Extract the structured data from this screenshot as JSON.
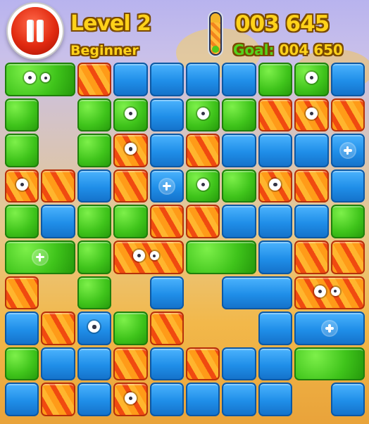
{
  "hud": {
    "level_label": "Level 2",
    "difficulty": "Beginner",
    "score": "003 645",
    "goal_label": "Goal:",
    "goal_value": "004 650",
    "progress": 0.78
  },
  "board": {
    "columns": 10,
    "rows": 10,
    "colors": {
      "green": "#3fc41b",
      "blue": "#1f8ee8",
      "orange": "#f26a12"
    },
    "blocks": [
      {
        "c": 0,
        "r": 0,
        "w": 2,
        "h": 1,
        "t": "g",
        "mark": "eyes"
      },
      {
        "c": 2,
        "r": 0,
        "w": 1,
        "h": 1,
        "t": "o"
      },
      {
        "c": 3,
        "r": 0,
        "w": 1,
        "h": 1,
        "t": "b"
      },
      {
        "c": 4,
        "r": 0,
        "w": 1,
        "h": 1,
        "t": "b"
      },
      {
        "c": 5,
        "r": 0,
        "w": 1,
        "h": 1,
        "t": "b"
      },
      {
        "c": 6,
        "r": 0,
        "w": 1,
        "h": 1,
        "t": "b"
      },
      {
        "c": 7,
        "r": 0,
        "w": 1,
        "h": 1,
        "t": "g"
      },
      {
        "c": 8,
        "r": 0,
        "w": 1,
        "h": 1,
        "t": "g",
        "mark": "eye"
      },
      {
        "c": 9,
        "r": 0,
        "w": 1,
        "h": 1,
        "t": "b"
      },
      {
        "c": 0,
        "r": 1,
        "w": 1,
        "h": 1,
        "t": "g"
      },
      {
        "c": 2,
        "r": 1,
        "w": 1,
        "h": 1,
        "t": "g"
      },
      {
        "c": 3,
        "r": 1,
        "w": 1,
        "h": 1,
        "t": "g",
        "mark": "eye"
      },
      {
        "c": 4,
        "r": 1,
        "w": 1,
        "h": 1,
        "t": "b"
      },
      {
        "c": 5,
        "r": 1,
        "w": 1,
        "h": 1,
        "t": "g",
        "mark": "eye"
      },
      {
        "c": 6,
        "r": 1,
        "w": 1,
        "h": 1,
        "t": "g"
      },
      {
        "c": 7,
        "r": 1,
        "w": 1,
        "h": 1,
        "t": "o"
      },
      {
        "c": 8,
        "r": 1,
        "w": 1,
        "h": 1,
        "t": "o",
        "mark": "eye"
      },
      {
        "c": 9,
        "r": 1,
        "w": 1,
        "h": 1,
        "t": "o"
      },
      {
        "c": 0,
        "r": 2,
        "w": 1,
        "h": 1,
        "t": "g"
      },
      {
        "c": 2,
        "r": 2,
        "w": 1,
        "h": 1,
        "t": "g"
      },
      {
        "c": 3,
        "r": 2,
        "w": 1,
        "h": 1,
        "t": "o",
        "mark": "eye"
      },
      {
        "c": 4,
        "r": 2,
        "w": 1,
        "h": 1,
        "t": "b"
      },
      {
        "c": 5,
        "r": 2,
        "w": 1,
        "h": 1,
        "t": "o"
      },
      {
        "c": 6,
        "r": 2,
        "w": 1,
        "h": 1,
        "t": "b"
      },
      {
        "c": 7,
        "r": 2,
        "w": 1,
        "h": 1,
        "t": "b"
      },
      {
        "c": 8,
        "r": 2,
        "w": 1,
        "h": 1,
        "t": "b"
      },
      {
        "c": 9,
        "r": 2,
        "w": 1,
        "h": 1,
        "t": "b",
        "mark": "plus"
      },
      {
        "c": 0,
        "r": 3,
        "w": 1,
        "h": 1,
        "t": "o",
        "mark": "eye"
      },
      {
        "c": 1,
        "r": 3,
        "w": 1,
        "h": 1,
        "t": "o"
      },
      {
        "c": 2,
        "r": 3,
        "w": 1,
        "h": 1,
        "t": "b"
      },
      {
        "c": 3,
        "r": 3,
        "w": 1,
        "h": 1,
        "t": "o"
      },
      {
        "c": 4,
        "r": 3,
        "w": 1,
        "h": 1,
        "t": "b",
        "mark": "plus"
      },
      {
        "c": 5,
        "r": 3,
        "w": 1,
        "h": 1,
        "t": "g",
        "mark": "eye"
      },
      {
        "c": 6,
        "r": 3,
        "w": 1,
        "h": 1,
        "t": "g"
      },
      {
        "c": 7,
        "r": 3,
        "w": 1,
        "h": 1,
        "t": "o",
        "mark": "eye"
      },
      {
        "c": 8,
        "r": 3,
        "w": 1,
        "h": 1,
        "t": "o"
      },
      {
        "c": 9,
        "r": 3,
        "w": 1,
        "h": 1,
        "t": "b"
      },
      {
        "c": 0,
        "r": 4,
        "w": 1,
        "h": 1,
        "t": "g"
      },
      {
        "c": 1,
        "r": 4,
        "w": 1,
        "h": 1,
        "t": "b"
      },
      {
        "c": 2,
        "r": 4,
        "w": 1,
        "h": 1,
        "t": "g"
      },
      {
        "c": 3,
        "r": 4,
        "w": 1,
        "h": 1,
        "t": "g"
      },
      {
        "c": 4,
        "r": 4,
        "w": 1,
        "h": 1,
        "t": "o"
      },
      {
        "c": 5,
        "r": 4,
        "w": 1,
        "h": 1,
        "t": "o"
      },
      {
        "c": 6,
        "r": 4,
        "w": 1,
        "h": 1,
        "t": "b"
      },
      {
        "c": 7,
        "r": 4,
        "w": 1,
        "h": 1,
        "t": "b"
      },
      {
        "c": 8,
        "r": 4,
        "w": 1,
        "h": 1,
        "t": "b"
      },
      {
        "c": 9,
        "r": 4,
        "w": 1,
        "h": 1,
        "t": "g"
      },
      {
        "c": 0,
        "r": 5,
        "w": 2,
        "h": 1,
        "t": "g",
        "mark": "plus"
      },
      {
        "c": 2,
        "r": 5,
        "w": 1,
        "h": 1,
        "t": "g"
      },
      {
        "c": 3,
        "r": 5,
        "w": 2,
        "h": 1,
        "t": "o",
        "mark": "eyes"
      },
      {
        "c": 5,
        "r": 5,
        "w": 2,
        "h": 1,
        "t": "g"
      },
      {
        "c": 7,
        "r": 5,
        "w": 1,
        "h": 1,
        "t": "b"
      },
      {
        "c": 8,
        "r": 5,
        "w": 1,
        "h": 1,
        "t": "o"
      },
      {
        "c": 9,
        "r": 5,
        "w": 1,
        "h": 1,
        "t": "o"
      },
      {
        "c": 0,
        "r": 6,
        "w": 1,
        "h": 1,
        "t": "o"
      },
      {
        "c": 2,
        "r": 6,
        "w": 1,
        "h": 1,
        "t": "g"
      },
      {
        "c": 4,
        "r": 6,
        "w": 1,
        "h": 1,
        "t": "b"
      },
      {
        "c": 6,
        "r": 6,
        "w": 2,
        "h": 1,
        "t": "b"
      },
      {
        "c": 8,
        "r": 6,
        "w": 2,
        "h": 1,
        "t": "o",
        "mark": "eyes"
      },
      {
        "c": 0,
        "r": 7,
        "w": 1,
        "h": 1,
        "t": "b"
      },
      {
        "c": 1,
        "r": 7,
        "w": 1,
        "h": 1,
        "t": "o"
      },
      {
        "c": 2,
        "r": 7,
        "w": 1,
        "h": 1,
        "t": "b",
        "mark": "eye"
      },
      {
        "c": 3,
        "r": 7,
        "w": 1,
        "h": 1,
        "t": "g"
      },
      {
        "c": 4,
        "r": 7,
        "w": 1,
        "h": 1,
        "t": "o"
      },
      {
        "c": 7,
        "r": 7,
        "w": 1,
        "h": 1,
        "t": "b"
      },
      {
        "c": 8,
        "r": 7,
        "w": 2,
        "h": 1,
        "t": "b",
        "mark": "plus"
      },
      {
        "c": 0,
        "r": 8,
        "w": 1,
        "h": 1,
        "t": "g"
      },
      {
        "c": 1,
        "r": 8,
        "w": 1,
        "h": 1,
        "t": "b"
      },
      {
        "c": 2,
        "r": 8,
        "w": 1,
        "h": 1,
        "t": "b"
      },
      {
        "c": 3,
        "r": 8,
        "w": 1,
        "h": 1,
        "t": "o"
      },
      {
        "c": 4,
        "r": 8,
        "w": 1,
        "h": 1,
        "t": "b"
      },
      {
        "c": 5,
        "r": 8,
        "w": 1,
        "h": 1,
        "t": "o"
      },
      {
        "c": 6,
        "r": 8,
        "w": 1,
        "h": 1,
        "t": "b"
      },
      {
        "c": 7,
        "r": 8,
        "w": 1,
        "h": 1,
        "t": "b"
      },
      {
        "c": 8,
        "r": 8,
        "w": 2,
        "h": 1,
        "t": "g"
      },
      {
        "c": 0,
        "r": 9,
        "w": 1,
        "h": 1,
        "t": "b"
      },
      {
        "c": 1,
        "r": 9,
        "w": 1,
        "h": 1,
        "t": "o"
      },
      {
        "c": 2,
        "r": 9,
        "w": 1,
        "h": 1,
        "t": "b"
      },
      {
        "c": 3,
        "r": 9,
        "w": 1,
        "h": 1,
        "t": "o",
        "mark": "eye"
      },
      {
        "c": 4,
        "r": 9,
        "w": 1,
        "h": 1,
        "t": "b"
      },
      {
        "c": 5,
        "r": 9,
        "w": 1,
        "h": 1,
        "t": "b"
      },
      {
        "c": 6,
        "r": 9,
        "w": 1,
        "h": 1,
        "t": "b"
      },
      {
        "c": 7,
        "r": 9,
        "w": 1,
        "h": 1,
        "t": "b"
      },
      {
        "c": 9,
        "r": 9,
        "w": 1,
        "h": 1,
        "t": "b"
      }
    ]
  }
}
